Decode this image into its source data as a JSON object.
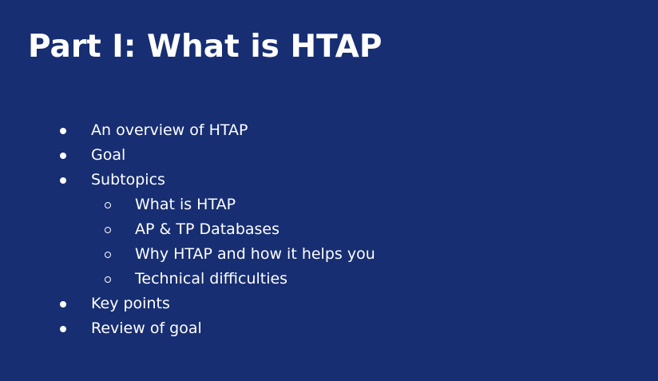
{
  "slide": {
    "title": "Part I: What is HTAP",
    "bullets": [
      {
        "text": "An overview of HTAP"
      },
      {
        "text": "Goal"
      },
      {
        "text": "Subtopics",
        "sub": [
          "What is HTAP",
          "AP & TP Databases",
          "Why HTAP and how it helps you",
          "Technical difficulties"
        ]
      },
      {
        "text": "Key points"
      },
      {
        "text": "Review of goal"
      }
    ]
  },
  "colors": {
    "background": "#172e72",
    "text": "#ffffff"
  }
}
